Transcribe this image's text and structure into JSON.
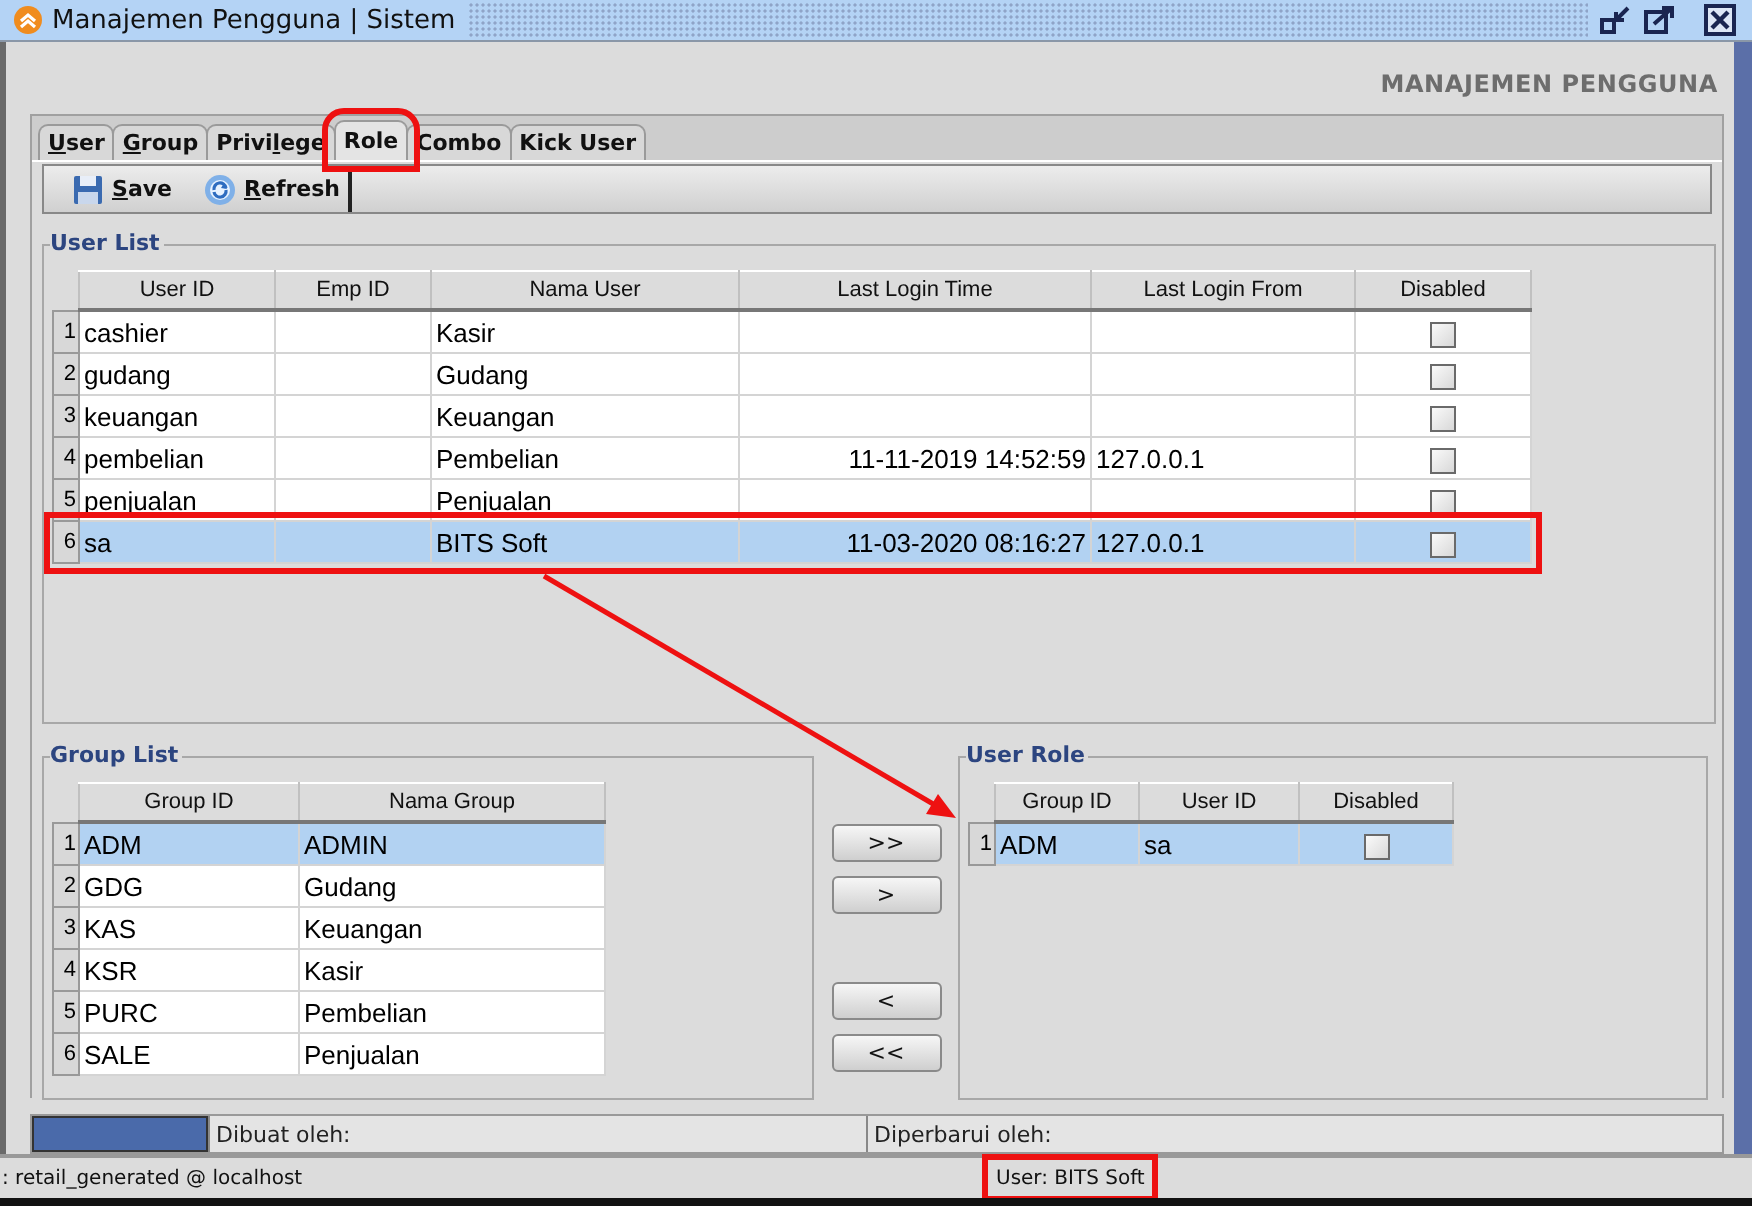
{
  "window": {
    "title": "Manajemen Pengguna | Sistem"
  },
  "header": "MANAJEMEN PENGGUNA",
  "tabs": [
    {
      "mnemonic": "U",
      "after": "ser",
      "selected": false,
      "highlighted": false
    },
    {
      "mnemonic": "G",
      "after": "roup",
      "selected": false,
      "highlighted": false
    },
    {
      "before": "Privi",
      "mnemonic": "l",
      "after": "ege",
      "selected": false,
      "highlighted": false
    },
    {
      "label": "Role",
      "selected": true,
      "highlighted": true
    },
    {
      "label": "Combo",
      "selected": false,
      "highlighted": false
    },
    {
      "label": "Kick User",
      "selected": false,
      "highlighted": false
    }
  ],
  "toolbar": [
    {
      "kind": "save",
      "label": "Save"
    },
    {
      "kind": "refresh",
      "label": "Refresh"
    }
  ],
  "user_list": {
    "title": "User List",
    "columns": [
      "User ID",
      "Emp ID",
      "Nama User",
      "Last Login Time",
      "Last Login From",
      "Disabled"
    ],
    "rows": [
      {
        "num": "1",
        "cells": [
          "cashier",
          "",
          "Kasir",
          "",
          ""
        ],
        "disabled": false,
        "selected": false,
        "highlighted": false
      },
      {
        "num": "2",
        "cells": [
          "gudang",
          "",
          "Gudang",
          "",
          ""
        ],
        "disabled": false,
        "selected": false,
        "highlighted": false
      },
      {
        "num": "3",
        "cells": [
          "keuangan",
          "",
          "Keuangan",
          "",
          ""
        ],
        "disabled": false,
        "selected": false,
        "highlighted": false
      },
      {
        "num": "4",
        "cells": [
          "pembelian",
          "",
          "Pembelian",
          "11-11-2019 14:52:59",
          "127.0.0.1"
        ],
        "disabled": false,
        "selected": false,
        "highlighted": false
      },
      {
        "num": "5",
        "cells": [
          "penjualan",
          "",
          "Penjualan",
          "",
          ""
        ],
        "disabled": false,
        "selected": false,
        "highlighted": false
      },
      {
        "num": "6",
        "cells": [
          "sa",
          "",
          "BITS Soft",
          "11-03-2020 08:16:27",
          "127.0.0.1"
        ],
        "disabled": false,
        "selected": true,
        "highlighted": true
      }
    ]
  },
  "group_list": {
    "title": "Group List",
    "columns": [
      "Group ID",
      "Nama Group"
    ],
    "rows": [
      {
        "num": "1",
        "cells": [
          "ADM",
          "ADMIN"
        ],
        "selected": true
      },
      {
        "num": "2",
        "cells": [
          "GDG",
          "Gudang"
        ],
        "selected": false
      },
      {
        "num": "3",
        "cells": [
          "KAS",
          "Keuangan"
        ],
        "selected": false
      },
      {
        "num": "4",
        "cells": [
          "KSR",
          "Kasir"
        ],
        "selected": false
      },
      {
        "num": "5",
        "cells": [
          "PURC",
          "Pembelian"
        ],
        "selected": false
      },
      {
        "num": "6",
        "cells": [
          "SALE",
          "Penjualan"
        ],
        "selected": false
      }
    ]
  },
  "move_buttons": [
    ">>",
    ">",
    "<",
    "<<"
  ],
  "user_role": {
    "title": "User Role",
    "columns": [
      "Group ID",
      "User ID",
      "Disabled"
    ],
    "rows": [
      {
        "num": "1",
        "cells": [
          "ADM",
          "sa"
        ],
        "disabled": false,
        "selected": true
      }
    ]
  },
  "annotation_arrow": true,
  "info_bar": {
    "created_by": "Dibuat oleh:",
    "updated_by": "Diperbarui oleh:"
  },
  "status_bar": [
    {
      "text": ": retail_generated @ localhost",
      "highlighted": false
    },
    {
      "text": "User: BITS Soft",
      "highlighted": true
    }
  ]
}
